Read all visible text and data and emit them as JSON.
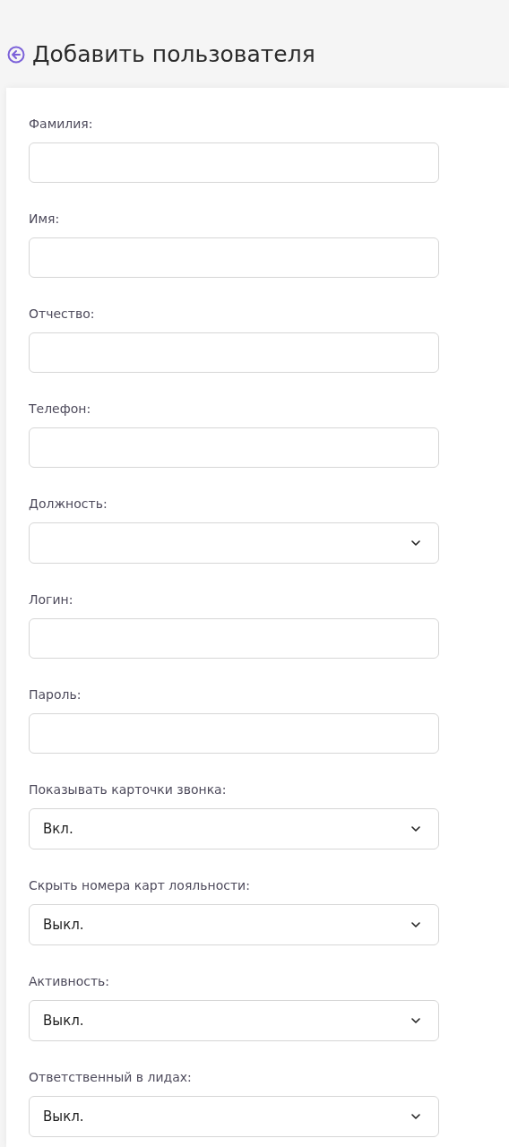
{
  "header": {
    "title": "Добавить пользователя"
  },
  "fields": [
    {
      "kind": "text",
      "label": "Фамилия:"
    },
    {
      "kind": "text",
      "label": "Имя:"
    },
    {
      "kind": "text",
      "label": "Отчество:"
    },
    {
      "kind": "text",
      "label": "Телефон:"
    },
    {
      "kind": "select",
      "label": "Должность:"
    },
    {
      "kind": "text",
      "label": "Логин:"
    },
    {
      "kind": "text",
      "label": "Пароль:"
    },
    {
      "kind": "select",
      "label": "Показывать карточки звонка:",
      "value": "Вкл."
    },
    {
      "kind": "select",
      "label": "Скрыть номера карт лояльности:",
      "value": "Выкл."
    },
    {
      "kind": "select",
      "label": "Активность:",
      "value": "Выкл."
    },
    {
      "kind": "select",
      "label": "Ответственный в лидах:",
      "value": "Выкл."
    }
  ]
}
